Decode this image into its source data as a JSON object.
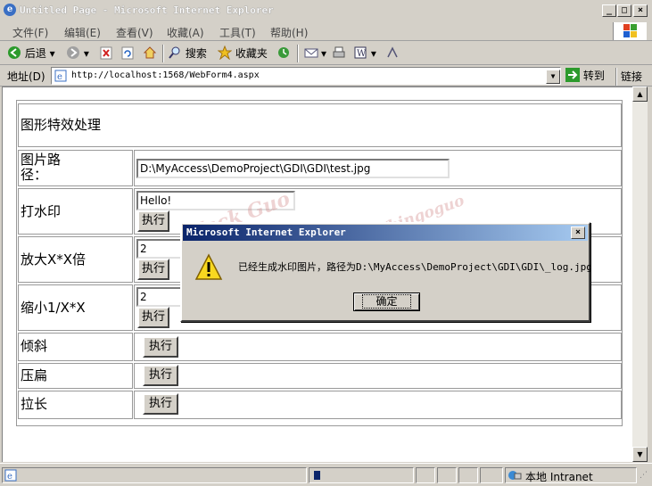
{
  "window": {
    "title": "Untitled Page - Microsoft Internet Explorer"
  },
  "menu": [
    "文件(F)",
    "编辑(E)",
    "查看(V)",
    "收藏(A)",
    "工具(T)",
    "帮助(H)"
  ],
  "toolbar": {
    "back": "后退",
    "search": "搜索",
    "favorites": "收藏夹"
  },
  "address": {
    "label": "地址(D)",
    "url": "http://localhost:1568/WebForm4.aspx",
    "go": "转到",
    "links": "链接"
  },
  "page": {
    "heading": "图形特效处理",
    "rows": [
      {
        "label": "图片路径：",
        "input": "D:\\MyAccess\\DemoProject\\GDI\\GDI\\test.jpg"
      },
      {
        "label": "打水印",
        "input": "Hello!",
        "button": "执行"
      },
      {
        "label": "放大X*X倍",
        "input": "2",
        "button": "执行"
      },
      {
        "label": "缩小1/X*X",
        "input": "2",
        "button": "执行"
      },
      {
        "label": "倾斜",
        "button": "执行"
      },
      {
        "label": "压扁",
        "button": "执行"
      },
      {
        "label": "拉长",
        "button": "执行"
      }
    ]
  },
  "dialog": {
    "title": "Microsoft Internet Explorer",
    "message": "已经生成水印图片，路径为D:\\MyAccess\\DemoProject\\GDI\\GDI\\_log.jpg",
    "ok": "确定"
  },
  "status": {
    "zone": "本地 Intranet"
  },
  "watermark": {
    "line1": "Jack Guo",
    "line2": "http://hi.baidu.com/bingoguo",
    "line3": "Jack Guo"
  }
}
